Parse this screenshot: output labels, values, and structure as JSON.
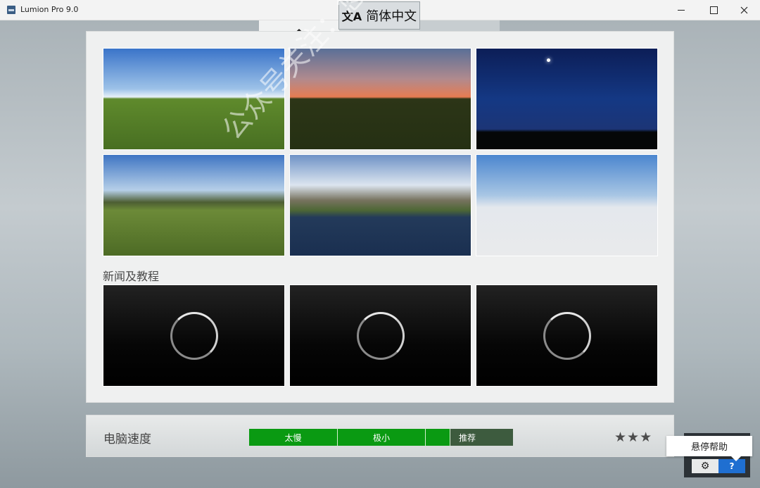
{
  "window": {
    "title": "Lumion Pro 9.0"
  },
  "tabs": {
    "language_label": "简体中文"
  },
  "panel": {
    "news_title": "新闻及教程"
  },
  "speed": {
    "label": "电脑速度",
    "segments": [
      "太慢",
      "极小",
      "",
      "推荐"
    ],
    "stars": "★★★"
  },
  "help": {
    "tooltip": "悬停帮助",
    "help_button": "?"
  },
  "watermark": "公众号关注：悠然软件管家",
  "icons": {
    "home": "home-icon",
    "translate": "translate-icon",
    "folder": "folder-open-icon",
    "settings": "gear-icon"
  },
  "colors": {
    "meter_green": "#0a9a12",
    "meter_dark": "#3d5b3e",
    "help_blue": "#1f6fd1"
  }
}
